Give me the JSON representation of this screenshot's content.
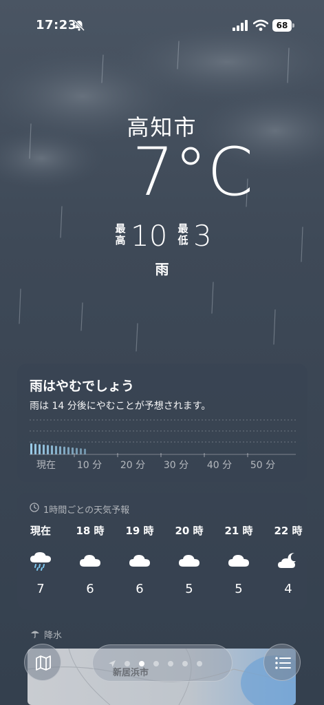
{
  "status_bar": {
    "time": "17:23",
    "battery": "68"
  },
  "location": {
    "city": "高知市",
    "temperature": "7°C",
    "high_label": "最高",
    "high": "10",
    "low_label": "最低",
    "low": "3",
    "condition": "雨"
  },
  "precipitation": {
    "title": "雨はやむでしょう",
    "description": "雨は 14 分後にやむことが予想されます。",
    "axis_labels": [
      "現在",
      "10 分",
      "20 分",
      "30 分",
      "40 分",
      "50 分"
    ],
    "bar_count": 14
  },
  "hourly": {
    "label": "1時間ごとの天気予報",
    "items": [
      {
        "time": "現在",
        "icon": "rain-cloud-icon",
        "temp": "7"
      },
      {
        "time": "18 時",
        "icon": "cloud-icon",
        "temp": "6"
      },
      {
        "time": "19 時",
        "icon": "cloud-icon",
        "temp": "6"
      },
      {
        "time": "20 時",
        "icon": "cloud-icon",
        "temp": "5"
      },
      {
        "time": "21 時",
        "icon": "cloud-icon",
        "temp": "5"
      },
      {
        "time": "22 時",
        "icon": "moon-cloud-icon",
        "temp": "4"
      }
    ]
  },
  "map": {
    "label": "降水",
    "city": "新居浜市"
  },
  "pager": {
    "count": 6,
    "active": 1
  },
  "colors": {
    "precip_bar": "#9fd3f0",
    "background": "#3e4957"
  }
}
